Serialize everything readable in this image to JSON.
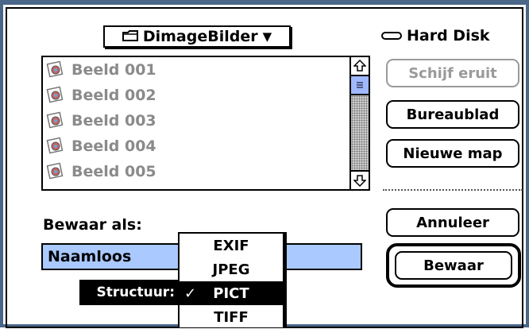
{
  "folder_popup": {
    "icon": "folder-icon",
    "label": "DimageBilder",
    "arrow": "▼"
  },
  "disk": {
    "icon": "hard-disk-icon",
    "label": "Hard Disk"
  },
  "file_list": {
    "items": [
      {
        "label": "Beeld 001",
        "icon": "picture-file-icon"
      },
      {
        "label": "Beeld 002",
        "icon": "picture-file-icon"
      },
      {
        "label": "Beeld 003",
        "icon": "picture-file-icon"
      },
      {
        "label": "Beeld 004",
        "icon": "picture-file-icon"
      },
      {
        "label": "Beeld 005",
        "icon": "picture-file-icon"
      }
    ],
    "scroll_up_icon": "arrow-up-icon",
    "scroll_down_icon": "arrow-down-icon"
  },
  "buttons": {
    "eject": "Schijf eruit",
    "desktop": "Bureaublad",
    "new_folder": "Nieuwe map",
    "cancel": "Annuleer",
    "save": "Bewaar"
  },
  "save_as": {
    "label": "Bewaar als:",
    "value": "Naamloos"
  },
  "format": {
    "label": "Structuur:",
    "options": [
      "EXIF",
      "JPEG",
      "PICT",
      "TIFF"
    ],
    "selected": "PICT",
    "check": "✓"
  },
  "colors": {
    "frame": "#4a6688",
    "selection": "#a9c9ff",
    "thumb": "#9fb8ff",
    "disabled": "#9a9a9a"
  }
}
